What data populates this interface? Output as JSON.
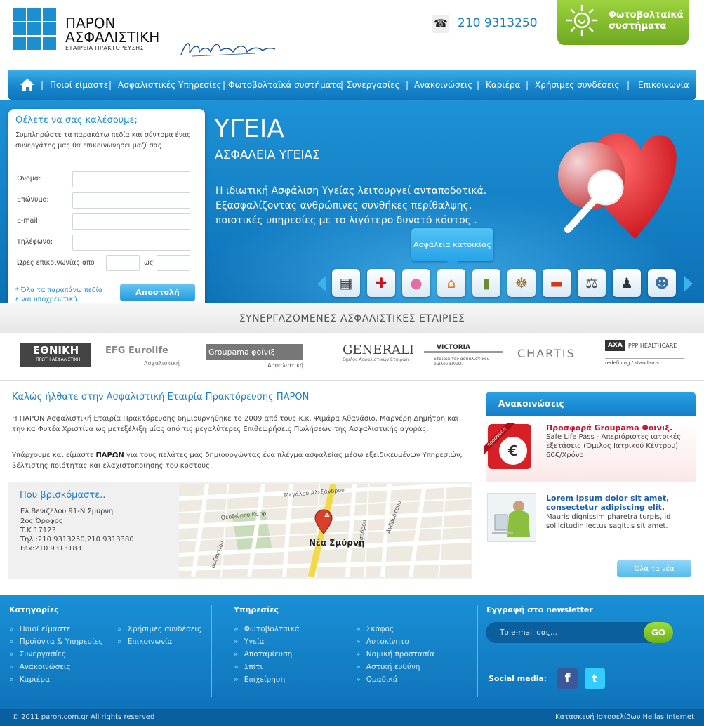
{
  "brand": {
    "name_line1": "ΠΑΡΟΝ",
    "name_line2": "ΑΣΦΑΛΙΣΤΙΚΗ",
    "tagline": "ΕΤΑΙΡΕΙΑ ΠΡΑΚΤΟΡΕΥΣΗΣ",
    "accent_color": "#1c8fd1"
  },
  "header": {
    "phone": "210 9313250",
    "phone_icon": "phone-icon",
    "pv_label_line1": "Φωτοβολταϊκά",
    "pv_label_line2": "συστήματα",
    "pv_color": "#8cc63f"
  },
  "nav": {
    "home_icon": "home-icon",
    "items": [
      {
        "label": "Ποιοί είμαστε"
      },
      {
        "label": "Ασφαλιστικές Υπηρεσίες"
      },
      {
        "label": "Φωτοβολταϊκά συστήματα"
      },
      {
        "label": "Συνεργασίες"
      },
      {
        "label": "Ανακοινώσεις"
      },
      {
        "label": "Καριέρα"
      },
      {
        "label": "Χρήσιμες συνδέσεις"
      },
      {
        "label": "Επικοινωνία"
      }
    ]
  },
  "callback": {
    "title": "Θέλετε να σας καλέσουμε;",
    "description": "Συμπληρώστε τα παρακάτω πεδία και σύντομα ένας συνεργάτης μας θα επικοινωνήσει μαζί σας",
    "fields": {
      "name": "Όνομα:",
      "surname": "Επώνυμο:",
      "email": "E-mail:",
      "phone": "Τηλέφωνο:"
    },
    "hours_label": "Ώρες επικοινωνίας από",
    "to_label": "ως",
    "note": "* Όλα τα παραπάνω πεδία είναι υποχρεωτικά",
    "submit": "Αποστολή"
  },
  "hero": {
    "title": "ΥΓΕΙΑ",
    "subtitle": "ΑΣΦΑΛΕΙΑ ΥΓΕΙΑΣ",
    "text": "Η ιδιωτική Ασφάλιση Υγείας λειτουργεί ανταποδοτικά. Εξασφαλίζοντας ανθρώπινες συνθήκες περίθαλψης, ποιοτικές υπηρεσίες με το λιγότερο δυνατό κόστος .",
    "tooltip": "Ασφάλεια κατοικίας",
    "icons": [
      "solar-panel-icon",
      "medical-cross-icon",
      "piggy-bank-icon",
      "house-icon",
      "building-icon",
      "ship-wheel-icon",
      "car-icon",
      "scale-icon",
      "businessman-icon",
      "group-icon"
    ]
  },
  "partners": {
    "title": "ΣΥΝΕΡΓΑΖΟΜΕΝΕΣ ΑΣΦΑΛΙΣΤΙΚΕΣ ΕΤΑΙΡΙΕΣ",
    "logos": [
      {
        "name": "ΕΘΝΙΚΗ",
        "sub": "Η ΠΡΩΤΗ ΑΣΦΑΛΙΣΤΙΚΗ"
      },
      {
        "name": "EFG Eurolife",
        "sub": "Ασφαλιστική"
      },
      {
        "name": "Groupama φοίνιξ",
        "sub": "Ασφαλιστική"
      },
      {
        "name": "GENERALI",
        "sub": "Όμιλος Ασφαλιστικών Εταιριών"
      },
      {
        "name": "VICTORIA",
        "sub": "Εταιρία του ασφαλιστικού ομίλου ERGO."
      },
      {
        "name": "CHARTIS",
        "sub": ""
      },
      {
        "name": "PPP HEALTHCARE",
        "sub": "redefining / standards"
      }
    ]
  },
  "welcome": {
    "title": "Καλώς ήλθατε στην Ασφαλιστική Εταιρία Πρακτόρευσης ΠΑΡΟΝ",
    "p1": "Η ΠΑΡΟΝ Ασφαλιστική Εταιρία Πρακτόρευσης δημιουργήθηκε το 2009 από τους κ.κ. Ψιμάρα Αθανάσιο, Μαρνέρη Δημήτρη και την κα Φυτέα Χριστίνα ως μετεξέλιξη μίας από τις μεγαλύτερες Επιθεωρήσεις Πωλήσεων της Ασφαλιστικής αγοράς.",
    "p2a": "Υπάρχουμε και είμαστε ",
    "p2b": "ΠΑΡΩΝ",
    "p2c": " για τους πελάτες μας δημιουργώντας ένα πλέγμα ασφαλείας μέσω εξειδικευμένων Υπηρεσιών, βέλτιστης ποιότητας και ελαχιστοποίησης του κόστους."
  },
  "location": {
    "title": "Που βρισκόμαστε..",
    "lines": [
      "Ελ.Βενιζέλου 91-Ν.Σμύρνη",
      "2ος Όροφος",
      "Τ.Κ 17123",
      "Τηλ.:210 9313250,210 9313380",
      "Fax:210 9313183"
    ],
    "map_label": "Νέα Σμύρνη",
    "map_pin": "A"
  },
  "news": {
    "title": "Ανακοινώσεις",
    "items": [
      {
        "title": "Προσφορά Groupama Φοινιξ.",
        "text": "Safe Life Pass - Απεριόριστες ιατρικές εξετάσεις (Όμιλος Ιατρικού Κέντρου) 60€/Χρόνο",
        "badge": "προσφορά",
        "color": "#c8102e"
      },
      {
        "title": "Lorem ipsum dolor sit amet, consectetur adipiscing elit.",
        "text": "Mauris dignissim pharetra turpis, id sollicitudin lectus sagittis sit amet.",
        "color": "#1b5ea8"
      }
    ],
    "all_button": "Όλα τα νέα"
  },
  "footer": {
    "categories_title": "Κατηγορίες",
    "categories_col1": [
      "Ποιοί είμαστε",
      "Προϊόντα & Υπηρεσίες",
      "Συνεργασίες",
      "Ανακοινώσεις",
      "Καριέρα"
    ],
    "categories_col2": [
      "Χρήσιμες συνδέσεις",
      "Επικοινωνία"
    ],
    "services_title": "Υπηρεσίες",
    "services_col1": [
      "Φωτοβολταϊκά",
      "Υγεία",
      "Αποταμίευση",
      "Σπίτι",
      "Επιχείρηση"
    ],
    "services_col2": [
      "Σκάφος",
      "Αυτοκίνητο",
      "Νομική προστασία",
      "Αστική ευθύνη",
      "Ομαδικά"
    ],
    "newsletter_title": "Εγγραφή στο newsletter",
    "newsletter_placeholder": "Το e-mail σας...",
    "newsletter_go": "GO",
    "social_label": "Social media:",
    "copyright": "© 2011 paron.com.gr All rights reserved",
    "credits": "Κατασκευή Ιστοσελίδων Hellas Internet"
  }
}
